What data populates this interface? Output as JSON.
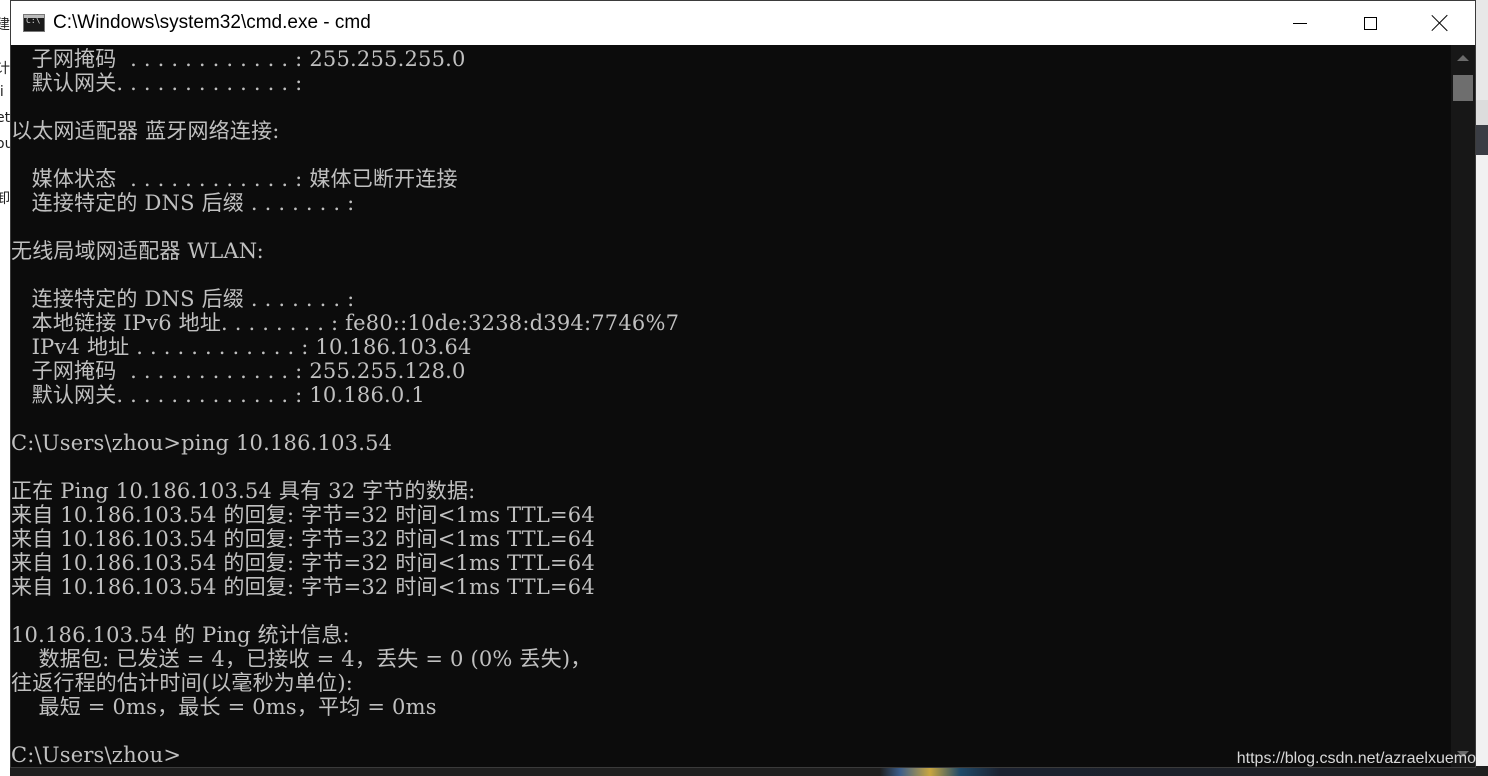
{
  "window": {
    "title": "C:\\Windows\\system32\\cmd.exe - cmd",
    "icon": "cmd-app-icon",
    "controls": [
      "minimize-icon",
      "maximize-icon",
      "close-icon"
    ]
  },
  "background_window": {
    "fragments": [
      "建",
      "计",
      "li",
      "et",
      "ou",
      "卸"
    ]
  },
  "console": {
    "lines": [
      "   子网掩码  . . . . . . . . . . . . : 255.255.255.0",
      "   默认网关. . . . . . . . . . . . . :",
      "",
      "以太网适配器 蓝牙网络连接:",
      "",
      "   媒体状态  . . . . . . . . . . . . : 媒体已断开连接",
      "   连接特定的 DNS 后缀 . . . . . . . :",
      "",
      "无线局域网适配器 WLAN:",
      "",
      "   连接特定的 DNS 后缀 . . . . . . . :",
      "   本地链接 IPv6 地址. . . . . . . . : fe80::10de:3238:d394:7746%7",
      "   IPv4 地址 . . . . . . . . . . . . : 10.186.103.64",
      "   子网掩码  . . . . . . . . . . . . : 255.255.128.0",
      "   默认网关. . . . . . . . . . . . . : 10.186.0.1",
      "",
      "C:\\Users\\zhou>ping 10.186.103.54",
      "",
      "正在 Ping 10.186.103.54 具有 32 字节的数据:",
      "来自 10.186.103.54 的回复: 字节=32 时间<1ms TTL=64",
      "来自 10.186.103.54 的回复: 字节=32 时间<1ms TTL=64",
      "来自 10.186.103.54 的回复: 字节=32 时间<1ms TTL=64",
      "来自 10.186.103.54 的回复: 字节=32 时间<1ms TTL=64",
      "",
      "10.186.103.54 的 Ping 统计信息:",
      "    数据包: 已发送 = 4，已接收 = 4，丢失 = 0 (0% 丢失)，",
      "往返行程的估计时间(以毫秒为单位):",
      "    最短 = 0ms，最长 = 0ms，平均 = 0ms",
      "",
      "C:\\Users\\zhou>"
    ]
  },
  "watermark": "https://blog.csdn.net/azraelxuemo",
  "colors": {
    "console_bg": "#0c0c0c",
    "console_fg": "#c0c0c0",
    "titlebar_bg": "#ffffff",
    "scrollbar_thumb": "#6e6e6e"
  }
}
